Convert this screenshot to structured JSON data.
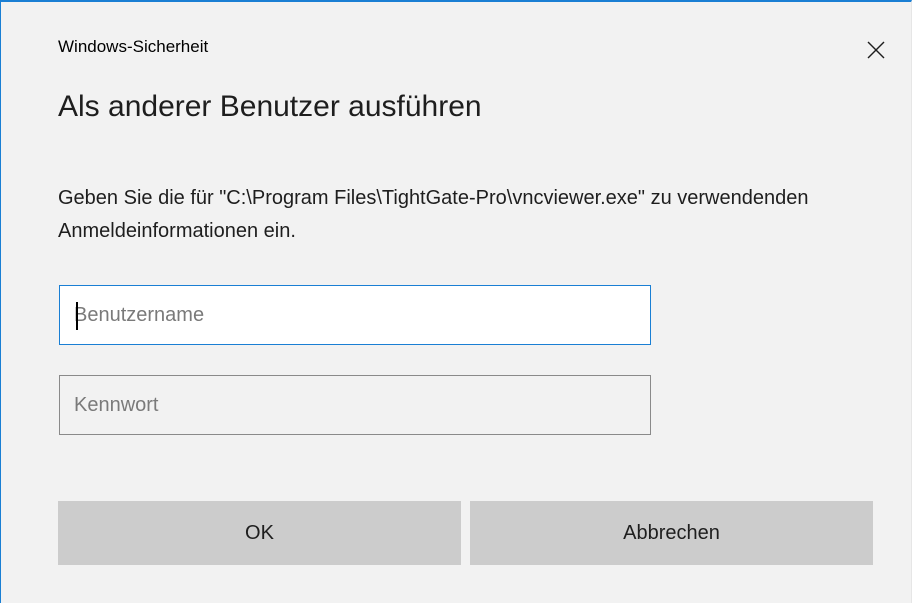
{
  "window": {
    "title": "Windows-Sicherheit",
    "close_icon": "close-icon"
  },
  "heading": "Als anderer Benutzer ausführen",
  "description": "Geben Sie die für \"C:\\Program Files\\TightGate-Pro\\vncviewer.exe\" zu verwendenden Anmeldeinformationen ein.",
  "fields": {
    "username": {
      "placeholder": "Benutzername",
      "value": "",
      "focused": true
    },
    "password": {
      "placeholder": "Kennwort",
      "value": ""
    }
  },
  "buttons": {
    "ok": "OK",
    "cancel": "Abbrechen"
  },
  "colors": {
    "accent": "#1a7fd4",
    "dialog_background": "#f2f2f2",
    "button_background": "#cccccc"
  }
}
